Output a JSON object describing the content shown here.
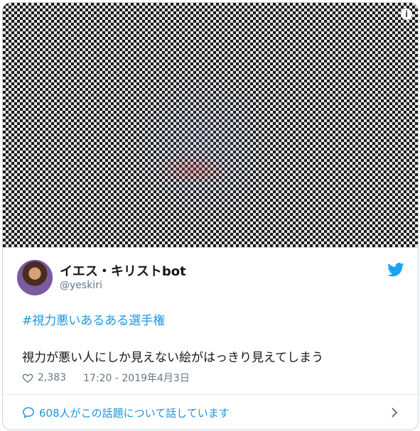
{
  "tweet": {
    "display_name": "イエス・キリストbot",
    "handle": "@yeskiri",
    "hashtag": "#視力悪いあるある選手権",
    "text": "視力が悪い人にしか見えない絵がはっきり見えてしまう",
    "likes": "2,383",
    "timestamp": "17:20 - 2019年4月3日"
  },
  "footer": {
    "conversation_text": "608人がこの話題について話しています"
  },
  "icons": {
    "info": "info-icon",
    "bird": "twitter-bird-icon",
    "heart": "heart-icon",
    "bubble": "speech-bubble-icon",
    "chevron": "chevron-right-icon"
  },
  "colors": {
    "accent": "#1b95e0",
    "text": "#14171a",
    "muted": "#657786",
    "border": "#ccd6dd"
  }
}
